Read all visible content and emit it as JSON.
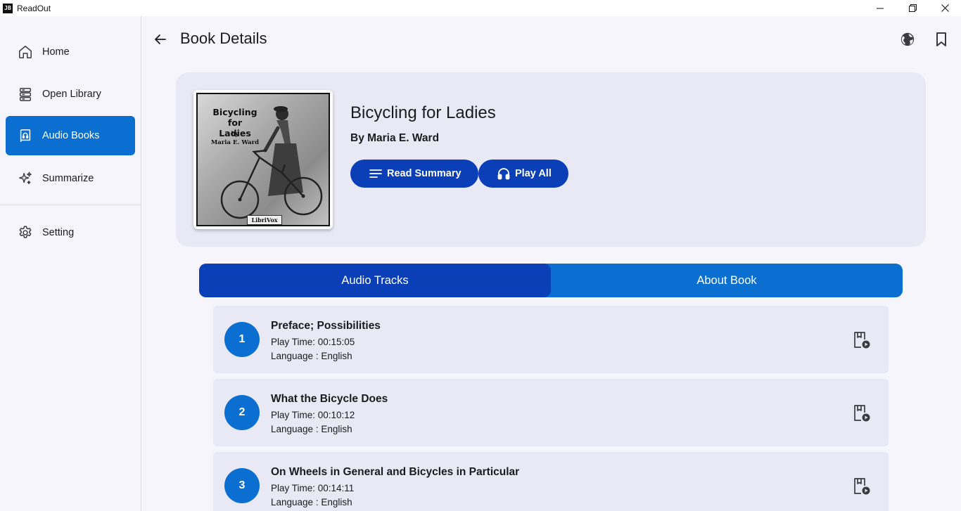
{
  "window": {
    "logo_text": "JB",
    "title": "ReadOut"
  },
  "sidebar": {
    "items": [
      {
        "label": "Home",
        "icon": "home-icon"
      },
      {
        "label": "Open Library",
        "icon": "library-icon"
      },
      {
        "label": "Audio Books",
        "icon": "audiobook-icon",
        "active": true
      },
      {
        "label": "Summarize",
        "icon": "sparkle-icon"
      },
      {
        "label": "Setting",
        "icon": "gear-icon"
      }
    ]
  },
  "header": {
    "title": "Book Details",
    "icons": [
      "globe-icon",
      "bookmark-icon"
    ]
  },
  "book": {
    "title": "Bicycling for Ladies",
    "author": "By Maria E. Ward",
    "cover": {
      "title": "Bicycling for Ladies",
      "by": "by",
      "author": "Maria E. Ward",
      "publisher": "LibriVox"
    },
    "read_summary_label": "Read Summary",
    "play_all_label": "Play All"
  },
  "tabs": [
    {
      "label": "Audio Tracks",
      "active": true
    },
    {
      "label": "About Book",
      "active": false
    }
  ],
  "tracks": [
    {
      "number": "1",
      "title": "Preface; Possibilities",
      "play_time": "Play Time: 00:15:05",
      "language": "Language : English"
    },
    {
      "number": "2",
      "title": "What the Bicycle Does",
      "play_time": "Play Time: 00:10:12",
      "language": "Language : English"
    },
    {
      "number": "3",
      "title": "On Wheels in General and Bicycles in Particular",
      "play_time": "Play Time: 00:14:11",
      "language": "Language : English"
    }
  ],
  "colors": {
    "accent": "#0a6fd0",
    "accent_dark": "#0a3fb8",
    "card_bg": "#e9e8f5",
    "page_bg": "#f6f5fb"
  }
}
